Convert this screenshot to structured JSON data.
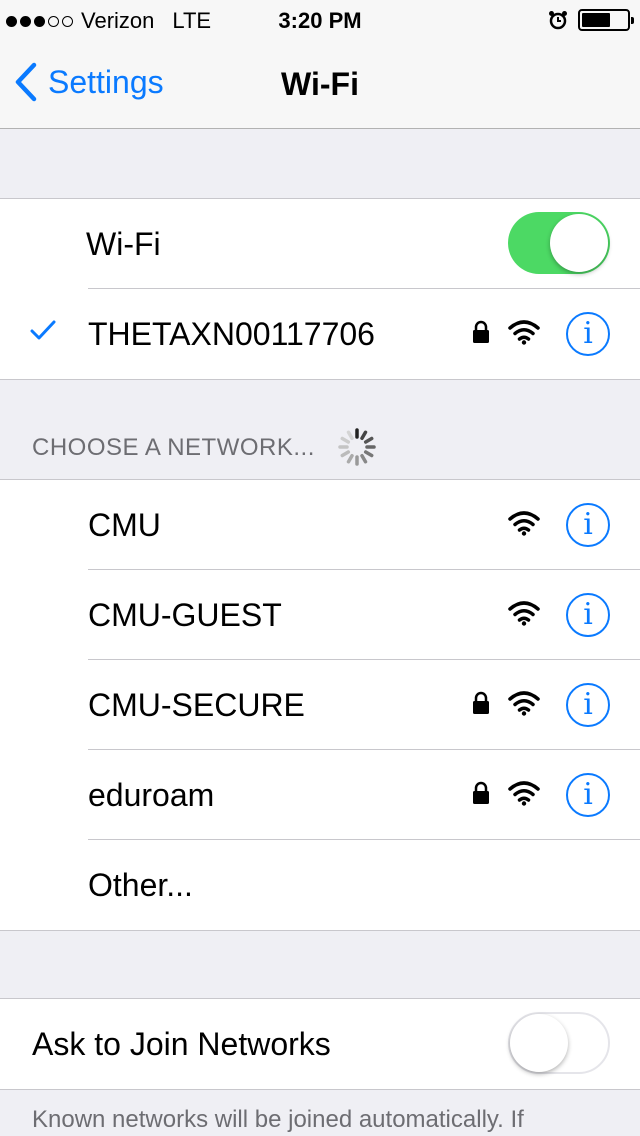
{
  "status_bar": {
    "signal_dots_filled": 3,
    "signal_dots_total": 5,
    "carrier": "Verizon",
    "network": "LTE",
    "time": "3:20 PM",
    "alarm_icon": "alarm-clock-icon",
    "battery_icon": "battery-icon"
  },
  "nav": {
    "back_label": "Settings",
    "title": "Wi-Fi"
  },
  "wifi_toggle": {
    "label": "Wi-Fi",
    "on": true
  },
  "connected_network": {
    "name": "THETAXN00117706",
    "secured": true
  },
  "networks_header": "CHOOSE A NETWORK...",
  "networks": [
    {
      "name": "CMU",
      "secured": false
    },
    {
      "name": "CMU-GUEST",
      "secured": false
    },
    {
      "name": "CMU-SECURE",
      "secured": true
    },
    {
      "name": "eduroam",
      "secured": true
    }
  ],
  "other_label": "Other...",
  "ask_to_join": {
    "label": "Ask to Join Networks",
    "on": false
  },
  "footer_text": "Known networks will be joined automatically. If",
  "colors": {
    "accent": "#0a7aff",
    "toggle_on": "#4cd964",
    "background": "#efeff4"
  }
}
